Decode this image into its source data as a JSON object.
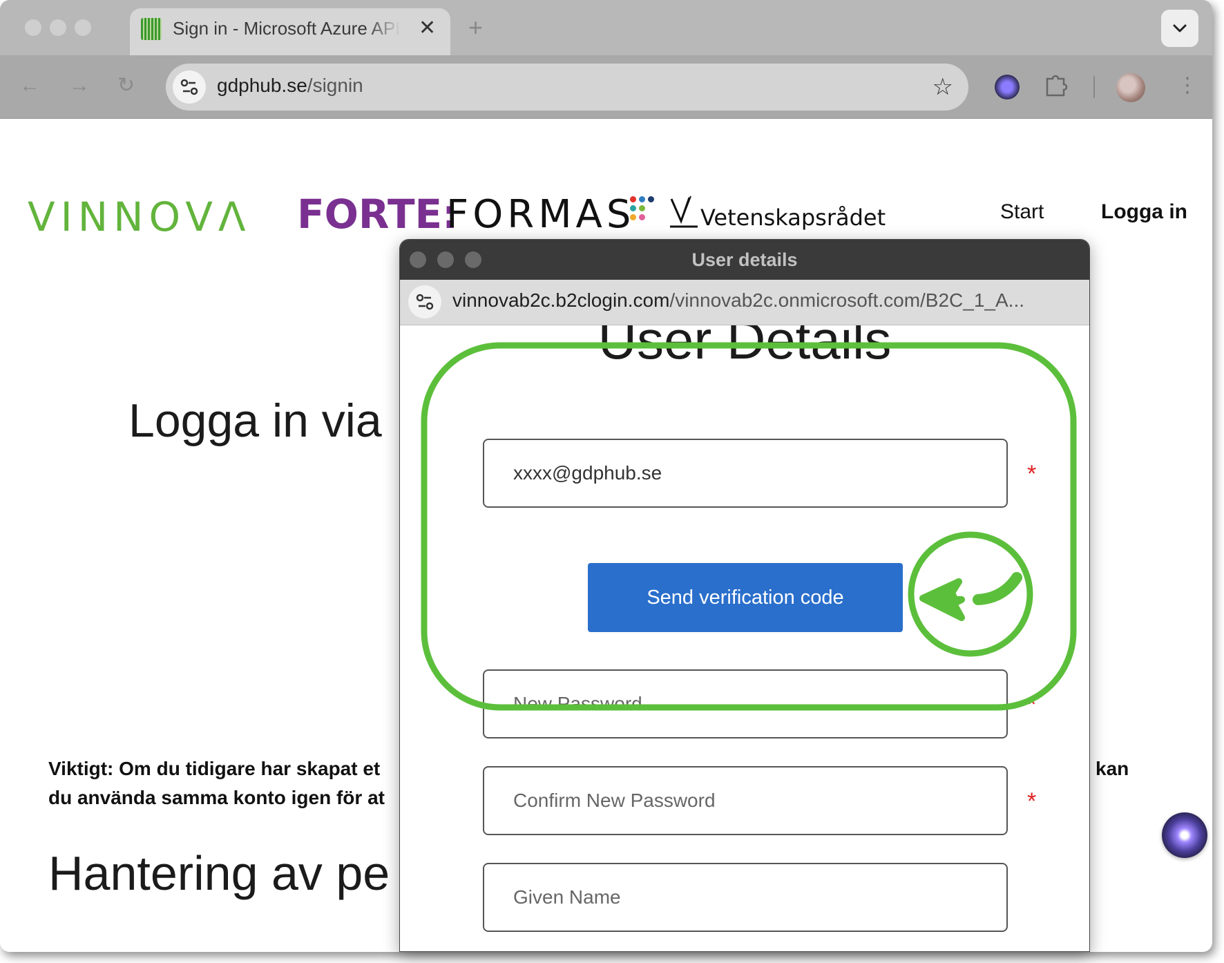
{
  "browser": {
    "tab_title": "Sign in - Microsoft Azure API",
    "tab_close": "✕",
    "new_tab": "+",
    "tab_menu_icon": "chevron-down-icon",
    "url_domain": "gdphub.se",
    "url_path": "/signin",
    "toolbar_icons": [
      "back-arrow-icon",
      "forward-arrow-icon",
      "reload-icon",
      "site-info-icon",
      "bookmark-star-icon",
      "sparkle-extension-icon",
      "puzzle-icon",
      "avatar",
      "kebab-menu-icon"
    ]
  },
  "site": {
    "logos": {
      "vinnova": "VINNOVΛ",
      "forte": "FORTE:",
      "formas": "FORMAS",
      "vr": "Vetenskapsrådet"
    },
    "nav": {
      "start": "Start",
      "login": "Logga in"
    },
    "heading_login": "Logga in via",
    "important_line1": "Viktigt: Om du tidigare har skapat et",
    "important_line1_right": "kan",
    "important_line2": "du använda samma konto igen för at",
    "heading_handling": "Hantering av pe"
  },
  "popup": {
    "window_title": "User details",
    "url_domain": "vinnovab2c.b2clogin.com",
    "url_path": "/vinnovab2c.onmicrosoft.com/B2C_1_A...",
    "form_title": "User Details",
    "email_value": "xxxx@gdphub.se",
    "send_button": "Send verification code",
    "new_password_placeholder": "New Password",
    "confirm_password_placeholder": "Confirm New Password",
    "given_name_placeholder": "Given Name",
    "required_marker": "*"
  },
  "colors": {
    "annotation_green": "#5cbf3b",
    "primary_button": "#2a6fcb",
    "vinnova_green": "#62b43c",
    "forte_purple": "#7a3090",
    "required_red": "#e02020"
  }
}
